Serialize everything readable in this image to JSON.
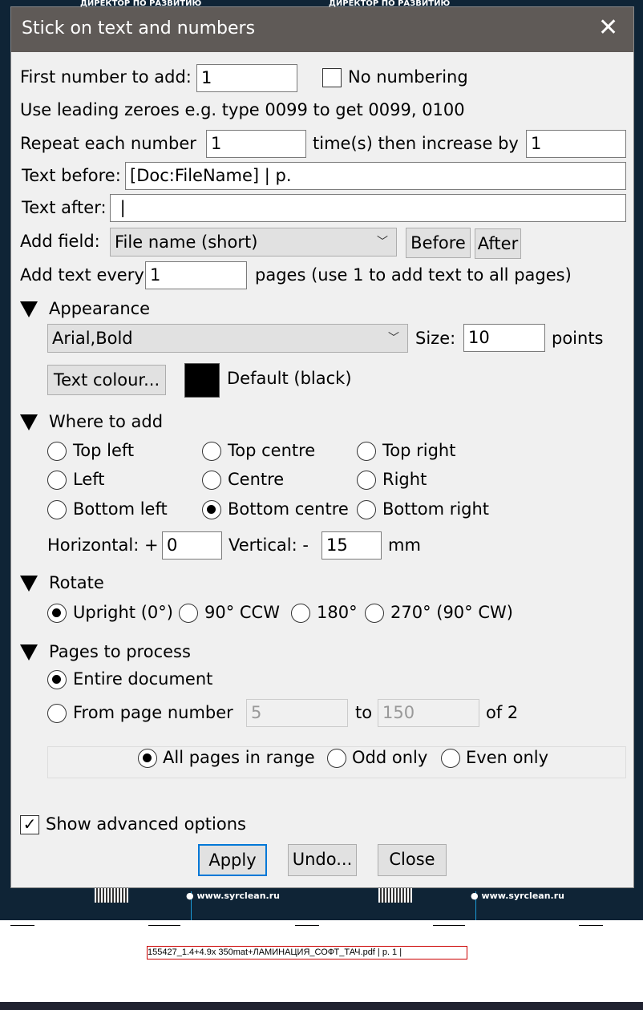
{
  "background": {
    "header_text": "ДИРЕКТОР ПО РАЗВИТИЮ",
    "site": "www.syrclean.ru",
    "stamp_text": "155427_1.4+4.9x 350mat+ЛАМИНАЦИЯ_СОФТ_ТАЧ.pdf | p. 1 |"
  },
  "dialog": {
    "title": "Stick on text and numbers",
    "close_icon": "close-icon",
    "first_number_label": "First number to add:",
    "first_number_value": "1",
    "no_numbering_label": "No numbering",
    "no_numbering_checked": false,
    "leading_zeroes_hint": "Use leading zeroes e.g. type 0099 to get 0099, 0100",
    "repeat_label": "Repeat each number",
    "repeat_value": "1",
    "increase_label": "time(s) then increase by",
    "increase_value": "1",
    "text_before_label": "Text before:",
    "text_before_value": "[Doc:FileName] | p.",
    "text_after_label": "Text after:",
    "text_after_value": " |",
    "add_field_label": "Add field:",
    "add_field_value": "File name (short)",
    "before_button": "Before",
    "after_button": "After",
    "every_label": "Add text every",
    "every_value": "1",
    "every_suffix": "pages (use 1 to add text to all pages)",
    "appearance": {
      "heading": "Appearance",
      "font_value": "Arial,Bold",
      "size_label": "Size:",
      "size_value": "10",
      "size_unit": "points",
      "colour_button": "Text colour...",
      "colour_value": "#000000",
      "colour_label": "Default (black)"
    },
    "where": {
      "heading": "Where to add",
      "options": [
        "Top left",
        "Top centre",
        "Top right",
        "Left",
        "Centre",
        "Right",
        "Bottom left",
        "Bottom centre",
        "Bottom right"
      ],
      "selected": "Bottom centre",
      "horizontal_label": "Horizontal: +",
      "horizontal_value": "0",
      "vertical_label": "Vertical: -",
      "vertical_value": "15",
      "unit": "mm"
    },
    "rotate": {
      "heading": "Rotate",
      "options": [
        "Upright (0°)",
        "90° CCW",
        "180°",
        "270° (90° CW)"
      ],
      "selected": "Upright (0°)"
    },
    "pages": {
      "heading": "Pages to process",
      "entire": "Entire document",
      "from": "From page number",
      "from_value": "5",
      "to_label": "to",
      "to_value": "150",
      "of_label": "of 2",
      "selected": "Entire document",
      "range_options": [
        "All pages in range",
        "Odd only",
        "Even only"
      ],
      "range_selected": "All pages in range"
    },
    "advanced_label": "Show advanced options",
    "advanced_checked": true,
    "apply": "Apply",
    "undo": "Undo...",
    "close": "Close"
  }
}
